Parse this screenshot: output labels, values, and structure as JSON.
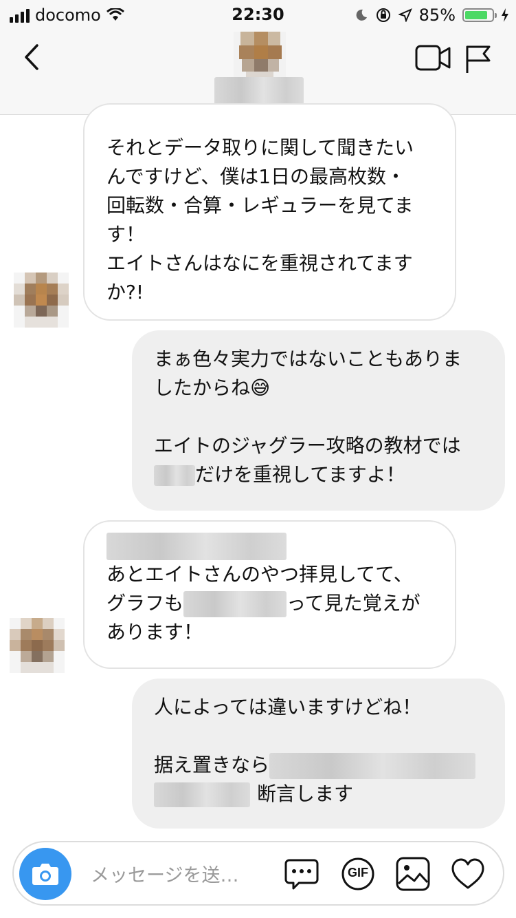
{
  "status_bar": {
    "carrier": "docomo",
    "time": "22:30",
    "battery": "85%",
    "battery_level": 0.85
  },
  "messages": [
    {
      "direction": "received",
      "lines": [
        "それとデータ取りに関して聞きたい",
        "んですけど、僕は1日の最高枚数・",
        "回転数・合算・レギュラーを見てま",
        "す！",
        "エイトさんはなにを重視されてます",
        "か?!"
      ]
    },
    {
      "direction": "sent",
      "line1": "まぁ色々実力ではないこともありま",
      "line2": "したからね",
      "emoji": "😅",
      "line3": "エイトのジャグラー攻略の教材では",
      "line4_suffix": "だけを重視してますよ！"
    },
    {
      "direction": "received",
      "line2": "あとエイトさんのやつ拝見してて、",
      "line3_prefix": "グラフも",
      "line3_suffix": "って見た覚えが",
      "line4": "あります！"
    },
    {
      "direction": "sent",
      "line1": "人によっては違いますけどね！",
      "line2_prefix": "据え置きなら",
      "line3_suffix": "断言します"
    }
  ],
  "composer": {
    "placeholder": "メッセージを送…",
    "gif_label": "GIF"
  },
  "icons": [
    "back-chevron-icon",
    "video-call-icon",
    "flag-icon",
    "camera-icon",
    "chat-more-icon",
    "gif-icon",
    "image-icon",
    "heart-icon"
  ]
}
